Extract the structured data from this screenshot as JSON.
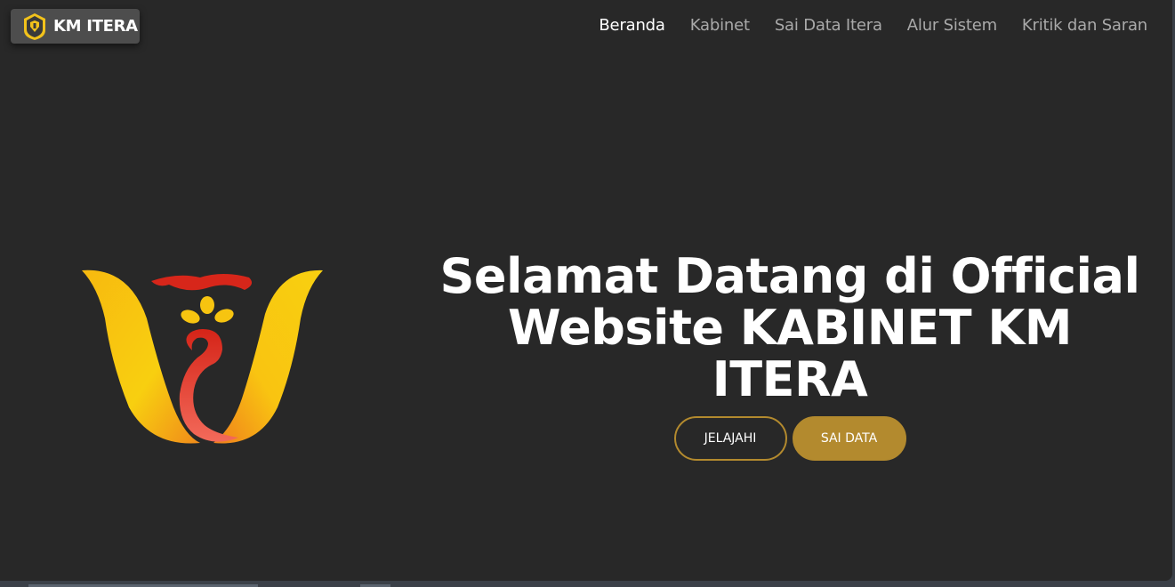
{
  "brand": {
    "name": "KM ITERA",
    "icon": "km-itera-logo-icon"
  },
  "nav": {
    "items": [
      {
        "label": "Beranda",
        "active": true
      },
      {
        "label": "Kabinet",
        "active": false
      },
      {
        "label": "Sai Data Itera",
        "active": false
      },
      {
        "label": "Alur Sistem",
        "active": false
      },
      {
        "label": "Kritik dan Saran",
        "active": false
      }
    ]
  },
  "hero": {
    "title_lines": [
      "Selamat Datang di Official",
      "Website KABINET KM",
      "ITERA"
    ],
    "logo": "kabinet-logo-icon",
    "buttons": {
      "explore_label": "JELAJAHI",
      "data_label": "SAI DATA"
    }
  },
  "colors": {
    "background": "#282828",
    "accent": "#b38a2e",
    "nav_active": "#ffffff",
    "nav_inactive": "#a9a9a9",
    "brand_bg": "#4d4d4d"
  }
}
